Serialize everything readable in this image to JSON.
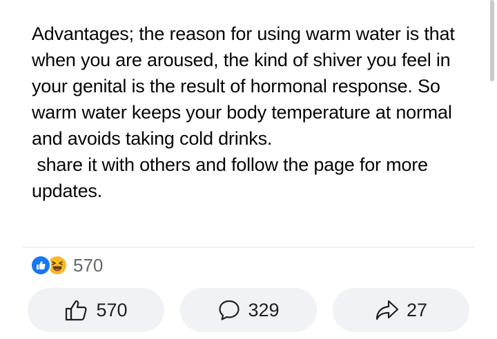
{
  "post": {
    "paragraphs": [
      "Advantages; the reason for using warm water is that when you are aroused, the kind of shiver you feel in your genital is the result of hormonal response. So warm water keeps your body temperature at normal and avoids taking cold drinks.",
      " share it with others and follow the page for more updates."
    ]
  },
  "reactions": {
    "icons": [
      "like-icon",
      "haha-icon"
    ],
    "count": "570"
  },
  "actions": {
    "like": {
      "icon": "thumbs-up-icon",
      "count": "570"
    },
    "comment": {
      "icon": "speech-bubble-icon",
      "count": "329"
    },
    "share": {
      "icon": "share-arrow-icon",
      "count": "27"
    }
  },
  "colors": {
    "like_blue": "#1877f2",
    "haha_yellow": "#f7b928",
    "button_bg": "#f0f2f5",
    "muted_text": "#65676b"
  }
}
